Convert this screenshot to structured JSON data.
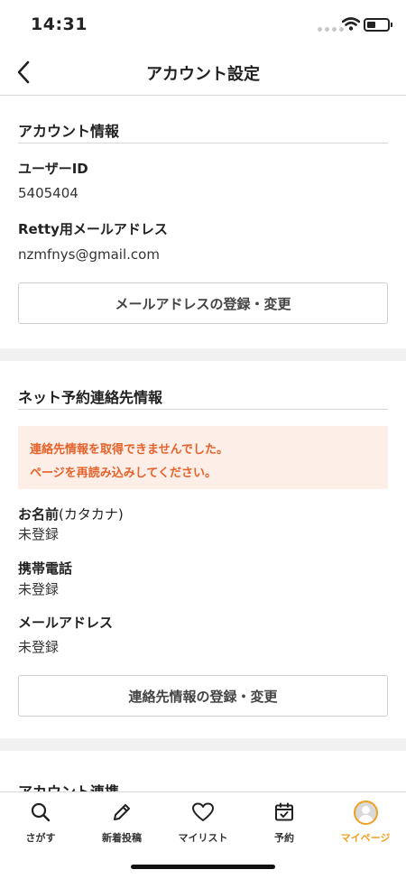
{
  "status_bar": {
    "time": "14:31"
  },
  "nav": {
    "title": "アカウント設定"
  },
  "account_info": {
    "title": "アカウント情報",
    "user_id_label": "ユーザーID",
    "user_id_value": "5405404",
    "email_label": "Retty用メールアドレス",
    "email_value": "nzmfnys@gmail.com",
    "button_label": "メールアドレスの登録・変更"
  },
  "contact_info": {
    "title": "ネット予約連絡先情報",
    "error_line1": "連絡先情報を取得できませんでした。",
    "error_line2": "ページを再読み込みしてください。",
    "name_label": "お名前",
    "name_label_sub": "(カタカナ)",
    "name_value": "未登録",
    "phone_label": "携帯電話",
    "phone_value": "未登録",
    "email_label": "メールアドレス",
    "email_value": "未登録",
    "button_label": "連絡先情報の登録・変更"
  },
  "account_link": {
    "title": "アカウント連携"
  },
  "tab_bar": {
    "items": [
      {
        "label": "さがす",
        "icon": "search-icon"
      },
      {
        "label": "新着投稿",
        "icon": "pencil-icon"
      },
      {
        "label": "マイリスト",
        "icon": "heart-icon"
      },
      {
        "label": "予約",
        "icon": "calendar-check-icon"
      },
      {
        "label": "マイページ",
        "icon": "avatar"
      }
    ],
    "active_index": 4,
    "active_color": "#f0a020"
  },
  "colors": {
    "error_text": "#e5622a",
    "error_background": "#fdeee8"
  }
}
